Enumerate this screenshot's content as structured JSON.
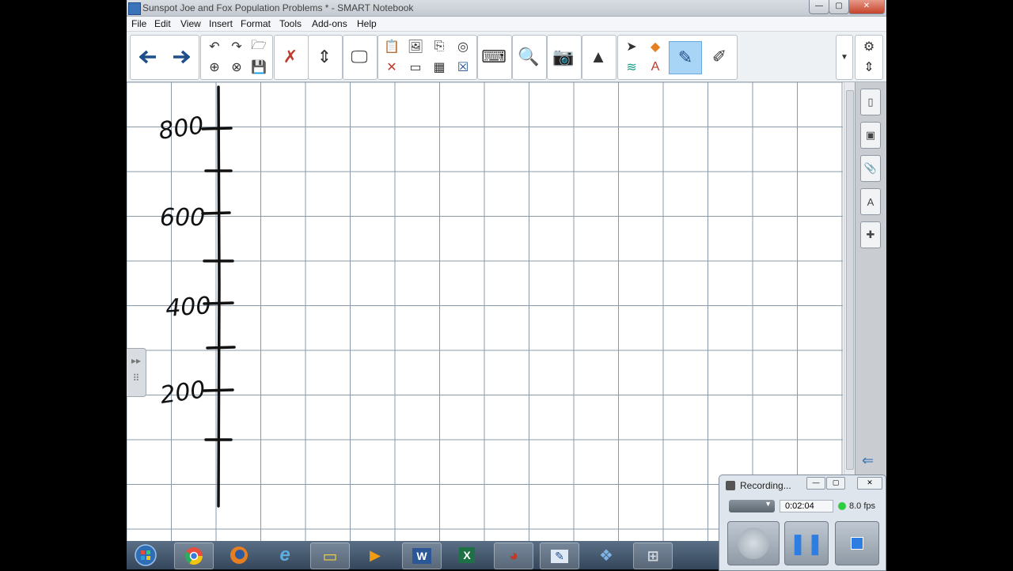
{
  "window": {
    "title": "Sunspot Joe and Fox Population Problems * - SMART Notebook",
    "min_label": "—",
    "max_label": "▢",
    "close_label": "✕"
  },
  "menu": [
    "File",
    "Edit",
    "View",
    "Insert",
    "Format",
    "Tools",
    "Add-ons",
    "Help"
  ],
  "canvas": {
    "axis_labels": [
      "800",
      "600",
      "400",
      "200"
    ]
  },
  "recording": {
    "title": "Recording...",
    "elapsed": "0:02:04",
    "fps": "8.0 fps",
    "status_color": "#2ecc40"
  },
  "taskbar": {
    "word_label": "W",
    "excel_label": "X"
  },
  "colors": {
    "active_tool": "#a8d4f5",
    "grid": "#8a99a8",
    "ink": "#111111"
  }
}
